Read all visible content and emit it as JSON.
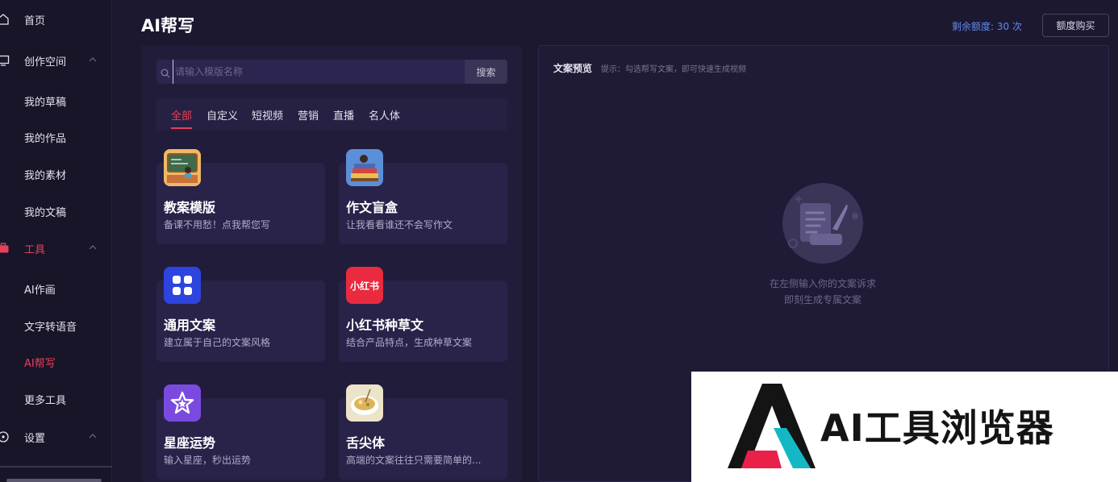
{
  "sidebar": {
    "items": [
      {
        "label": "首页",
        "icon": "home-icon"
      },
      {
        "label": "创作空间",
        "icon": "monitor-icon"
      },
      {
        "label": "我的草稿"
      },
      {
        "label": "我的作品"
      },
      {
        "label": "我的素材"
      },
      {
        "label": "我的文稿"
      },
      {
        "label": "工具",
        "icon": "toolbox-icon"
      },
      {
        "label": "AI作画"
      },
      {
        "label": "文字转语音"
      },
      {
        "label": "AI帮写"
      },
      {
        "label": "更多工具"
      },
      {
        "label": "设置",
        "icon": "settings-icon"
      }
    ],
    "active_label": "AI帮写",
    "accent_color": "#e8405a"
  },
  "header": {
    "title": "AI帮写",
    "quota_text": "剩余额度: 30 次",
    "buy_label": "额度购买"
  },
  "search": {
    "placeholder": "请输入模版名称",
    "button_label": "搜索"
  },
  "tabs": [
    {
      "label": "全部",
      "active": true
    },
    {
      "label": "自定义"
    },
    {
      "label": "短视频"
    },
    {
      "label": "营销"
    },
    {
      "label": "直播"
    },
    {
      "label": "名人体"
    }
  ],
  "cards": [
    {
      "title": "教案模版",
      "desc": "备课不用愁！点我帮您写",
      "icon": "classroom-icon"
    },
    {
      "title": "作文盲盒",
      "desc": "让我看看谁还不会写作文",
      "icon": "books-icon"
    },
    {
      "title": "通用文案",
      "desc": "建立属于自己的文案风格",
      "icon": "grid-icon"
    },
    {
      "title": "小红书种草文",
      "desc": "结合产品特点，生成种草文案",
      "icon": "xiaohongshu-icon",
      "icon_text": "小红书"
    },
    {
      "title": "星座运势",
      "desc": "输入星座，秒出运势",
      "icon": "star-icon"
    },
    {
      "title": "舌尖体",
      "desc": "高端的文案往往只需要简单的...",
      "icon": "soup-bowl-icon"
    }
  ],
  "preview": {
    "label": "文案预览",
    "hint": "提示：勾选帮写文案，即可快速生成视频",
    "empty_line1": "在左侧输入你的文案诉求",
    "empty_line2": "即刻生成专属文案"
  },
  "watermark": {
    "text": "AI工具浏览器"
  }
}
